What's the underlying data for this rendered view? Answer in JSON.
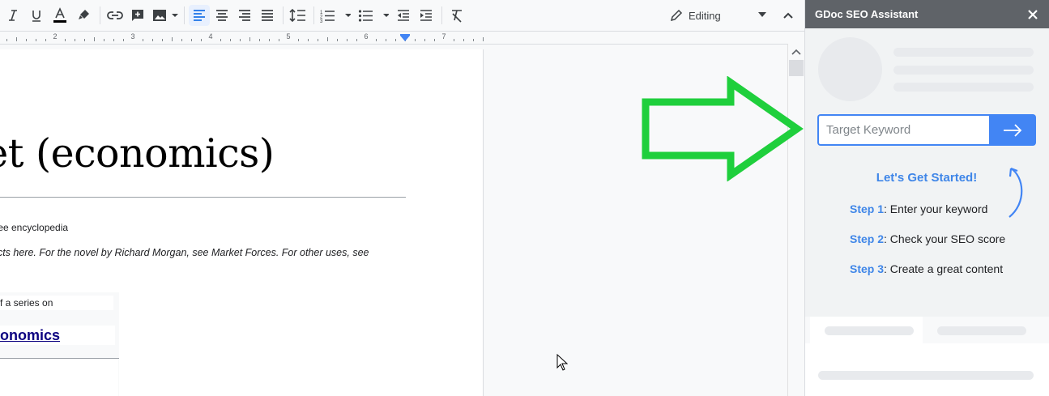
{
  "toolbar": {
    "buttons": [
      "italic",
      "underline",
      "text-color",
      "highlight",
      "link",
      "comment",
      "image",
      "align-left",
      "align-center",
      "align-right",
      "justify",
      "line-spacing",
      "numbered-list",
      "bulleted-list",
      "decrease-indent",
      "increase-indent",
      "clear-formatting"
    ],
    "mode_label": "Editing"
  },
  "ruler": {
    "numbers": [
      "2",
      "3",
      "4",
      "5",
      "6",
      "7"
    ]
  },
  "document": {
    "title_fragment": "ket (economics)",
    "subtitle_fragment": "free encyclopedia",
    "italic_fragment": "ects here. For the novel by Richard Morgan, see Market Forces. For other uses, see",
    "sidebox_line": "f a series on",
    "sidebox_link": "onomics"
  },
  "panel": {
    "title": "GDoc SEO Assistant",
    "keyword_placeholder": "Target Keyword",
    "started_label": "Let's Get Started!",
    "steps": [
      {
        "label": "Step 1",
        "text": ": Enter your keyword"
      },
      {
        "label": "Step 2",
        "text": ": Check your SEO score"
      },
      {
        "label": "Step 3",
        "text": ": Create a great content"
      }
    ]
  },
  "colors": {
    "accent_blue": "#4285f4",
    "step_blue": "#3f86e8",
    "callout_green": "#1fcf3c",
    "panel_header": "#5f6368"
  },
  "icons": {
    "arrow_callout": "green-right-arrow-icon",
    "submit": "arrow-right-icon",
    "close": "close-icon",
    "cursor": "mouse-pointer-icon"
  }
}
